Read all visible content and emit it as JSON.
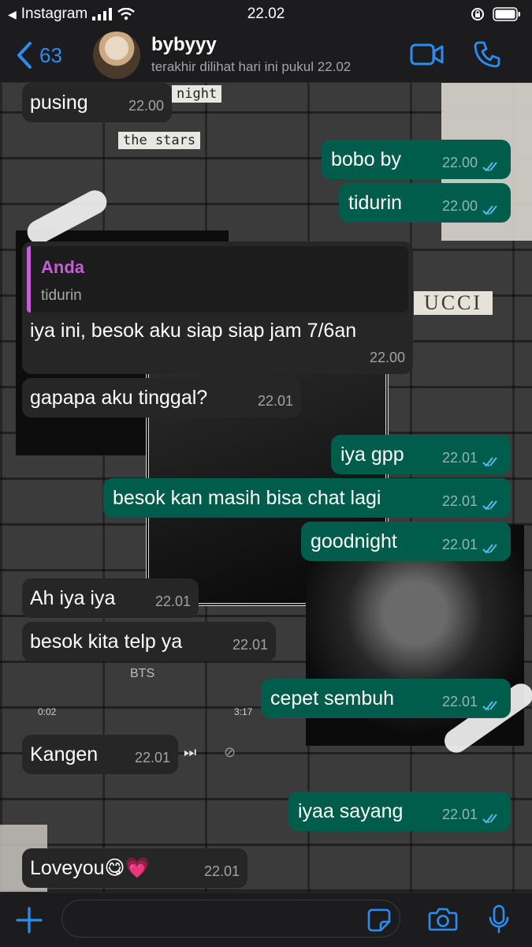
{
  "status_bar": {
    "back_app": "Instagram",
    "time": "22.02"
  },
  "header": {
    "back_count": "63",
    "contact_name": "bybyyy",
    "last_seen": "terakhir dilihat hari ini pukul 22.02"
  },
  "wallpaper": {
    "tag_night": "night",
    "tag_stars": "the stars",
    "brand": "UCCI",
    "music_artist": "BTS",
    "music_elapsed": "0:02",
    "music_total": "3:17"
  },
  "messages": [
    {
      "dir": "in",
      "text": "pusing",
      "time": "22.00"
    },
    {
      "dir": "out",
      "text": "bobo by",
      "time": "22.00"
    },
    {
      "dir": "out",
      "text": "tidurin",
      "time": "22.00"
    },
    {
      "dir": "in",
      "reply_to": {
        "name": "Anda",
        "text": "tidurin"
      },
      "text": "iya ini, besok aku siap siap jam 7/6an",
      "time": "22.00"
    },
    {
      "dir": "in",
      "text": "gapapa aku tinggal?",
      "time": "22.01"
    },
    {
      "dir": "out",
      "text": "iya gpp",
      "time": "22.01"
    },
    {
      "dir": "out",
      "text": "besok kan masih bisa chat lagi",
      "time": "22.01"
    },
    {
      "dir": "out",
      "text": "goodnight",
      "time": "22.01"
    },
    {
      "dir": "in",
      "text": "Ah iya iya",
      "time": "22.01"
    },
    {
      "dir": "in",
      "text": "besok kita telp ya",
      "time": "22.01"
    },
    {
      "dir": "out",
      "text": "cepet sembuh",
      "time": "22.01"
    },
    {
      "dir": "in",
      "text": "Kangen",
      "time": "22.01"
    },
    {
      "dir": "out",
      "text": "iyaa sayang",
      "time": "22.01"
    },
    {
      "dir": "in",
      "text": "Loveyou😋💗",
      "time": "22.01"
    }
  ],
  "composer": {
    "placeholder": ""
  },
  "colors": {
    "accent": "#2b8df2",
    "outgoing_bubble": "#005c4b",
    "incoming_bubble": "#262626",
    "read_ticks": "#53bdeb",
    "reply_name": "#c55fd7"
  }
}
